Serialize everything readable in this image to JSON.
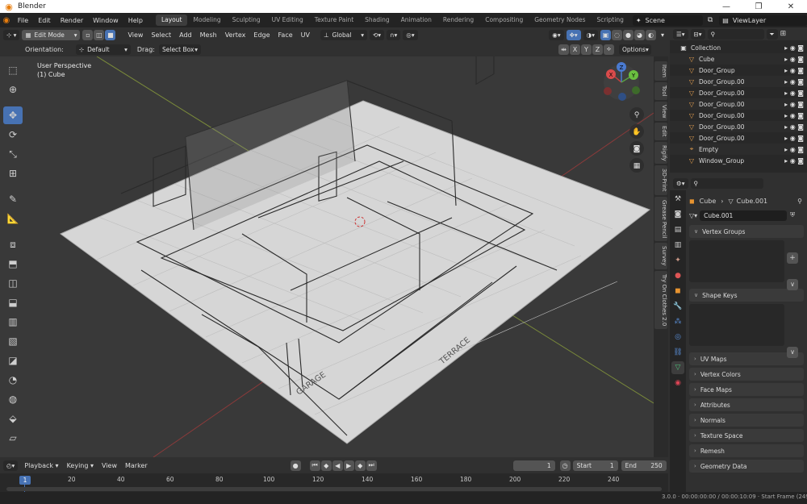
{
  "window": {
    "title": "Blender",
    "minimize": "—",
    "maximize": "❐",
    "close": "✕"
  },
  "menu": [
    "File",
    "Edit",
    "Render",
    "Window",
    "Help"
  ],
  "workspaces": [
    "Layout",
    "Modeling",
    "Sculpting",
    "UV Editing",
    "Texture Paint",
    "Shading",
    "Animation",
    "Rendering",
    "Compositing",
    "Geometry Nodes",
    "Scripting"
  ],
  "active_workspace": "Layout",
  "scene": "Scene",
  "view_layer": "ViewLayer",
  "viewport_header": {
    "mode": "Edit Mode",
    "menus": [
      "View",
      "Select",
      "Add",
      "Mesh",
      "Vertex",
      "Edge",
      "Face",
      "UV"
    ],
    "transform_orientation": "Global"
  },
  "tool_settings": {
    "orientation_label": "Orientation:",
    "orientation_value": "Default",
    "drag_label": "Drag:",
    "drag_value": "Select Box",
    "axes": [
      "X",
      "Y",
      "Z"
    ],
    "options": "Options"
  },
  "viewport": {
    "perspective": "User Perspective",
    "object": "(1) Cube",
    "labels": [
      "GARAGE",
      "TERRACE"
    ],
    "gizmo": {
      "x": "X",
      "y": "Y",
      "z": "Z"
    }
  },
  "n_tabs": [
    "Item",
    "Tool",
    "View",
    "Edit",
    "Rigify",
    "3D-Print",
    "Grease Pencil",
    "Survey",
    "Try On Clothes 2.0"
  ],
  "outliner": {
    "items": [
      {
        "name": "Collection",
        "icon": "collection-icon"
      },
      {
        "name": "Cube",
        "icon": "mesh-icon"
      },
      {
        "name": "Door_Group",
        "icon": "mesh-icon"
      },
      {
        "name": "Door_Group.00",
        "icon": "mesh-icon"
      },
      {
        "name": "Door_Group.00",
        "icon": "mesh-icon"
      },
      {
        "name": "Door_Group.00",
        "icon": "mesh-icon"
      },
      {
        "name": "Door_Group.00",
        "icon": "mesh-icon"
      },
      {
        "name": "Door_Group.00",
        "icon": "mesh-icon"
      },
      {
        "name": "Door_Group.00",
        "icon": "mesh-icon"
      },
      {
        "name": "Empty",
        "icon": "empty-icon"
      },
      {
        "name": "Window_Group",
        "icon": "mesh-icon"
      }
    ]
  },
  "properties": {
    "breadcrumb_object": "Cube",
    "breadcrumb_data": "Cube.001",
    "data_name": "Cube.001",
    "panels": [
      "Vertex Groups",
      "Shape Keys",
      "UV Maps",
      "Vertex Colors",
      "Face Maps",
      "Attributes",
      "Normals",
      "Texture Space",
      "Remesh",
      "Geometry Data"
    ]
  },
  "timeline": {
    "menus": [
      "Playback",
      "Keying",
      "View",
      "Marker"
    ],
    "current_frame": "1",
    "start_label": "Start",
    "start": "1",
    "end_label": "End",
    "end": "250",
    "ticks": [
      "1",
      "20",
      "40",
      "60",
      "80",
      "100",
      "120",
      "140",
      "160",
      "180",
      "200",
      "220",
      "240"
    ]
  },
  "status": "3.0.0 · 00:00:00:00 / 00:00:10:09 · Start Frame (249 left)"
}
